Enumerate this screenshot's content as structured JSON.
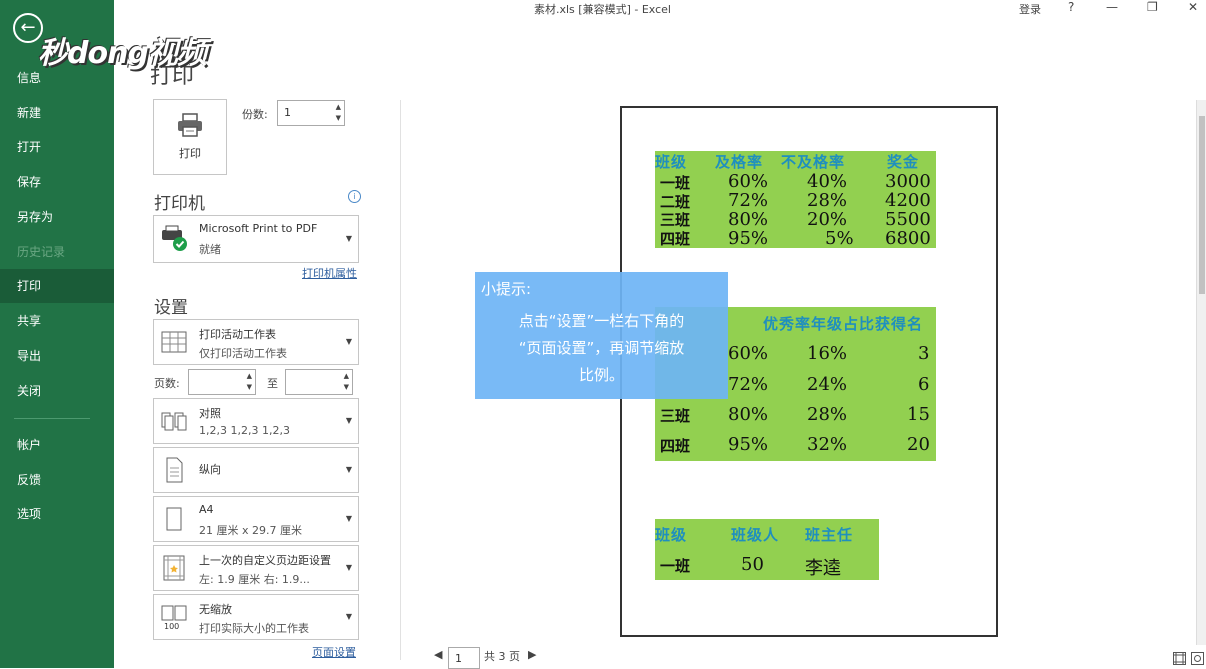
{
  "window": {
    "title": "素材.xls  [兼容模式]  -  Excel",
    "login": "登录",
    "help": "?",
    "minimize": "—",
    "restore": "❐",
    "close": "✕"
  },
  "watermark": "秒dong视频",
  "sidebar": {
    "back": "←",
    "items": [
      {
        "label": "信息"
      },
      {
        "label": "新建"
      },
      {
        "label": "打开"
      },
      {
        "label": "保存"
      },
      {
        "label": "另存为"
      },
      {
        "label": "历史记录"
      },
      {
        "label": "打印"
      },
      {
        "label": "共享"
      },
      {
        "label": "导出"
      },
      {
        "label": "关闭"
      },
      {
        "label": "帐户"
      },
      {
        "label": "反馈"
      },
      {
        "label": "选项"
      }
    ]
  },
  "print": {
    "heading": "打印",
    "button_label": "打印",
    "copies_label": "份数:",
    "copies_value": "1",
    "printer_section": "打印机",
    "printer_name": "Microsoft Print to PDF",
    "printer_status": "就绪",
    "printer_props": "打印机属性",
    "settings_section": "设置",
    "active_sheet": {
      "l1": "打印活动工作表",
      "l2": "仅打印活动工作表"
    },
    "pages_label": "页数:",
    "pages_to": "至",
    "collate": {
      "l1": "对照",
      "l2": "1,2,3    1,2,3    1,2,3"
    },
    "orientation": {
      "l1": "纵向"
    },
    "paper": {
      "l1": "A4",
      "l2": "21 厘米 x 29.7 厘米"
    },
    "margins": {
      "l1": "上一次的自定义页边距设置",
      "l2": "左: 1.9 厘米    右: 1.9..."
    },
    "scaling": {
      "l1": "无缩放",
      "l2": "打印实际大小的工作表"
    },
    "page_setup": "页面设置"
  },
  "preview": {
    "table1": {
      "headers": [
        "班级",
        "及格率",
        "不及格率",
        "奖金"
      ],
      "rows": [
        [
          "一班",
          "60%",
          "40%",
          "3000"
        ],
        [
          "二班",
          "72%",
          "28%",
          "4200"
        ],
        [
          "三班",
          "80%",
          "20%",
          "5500"
        ],
        [
          "四班",
          "95%",
          "5%",
          "6800"
        ]
      ]
    },
    "table2": {
      "header": "优秀率年级占比获得名",
      "rows": [
        [
          "",
          "60%",
          "16%",
          "3"
        ],
        [
          "",
          "72%",
          "24%",
          "6"
        ],
        [
          "三班",
          "80%",
          "28%",
          "15"
        ],
        [
          "四班",
          "95%",
          "32%",
          "20"
        ]
      ]
    },
    "table3": {
      "headers": [
        "班级",
        "班级人",
        "班主任"
      ],
      "rows": [
        [
          "一班",
          "50",
          "李逵"
        ]
      ]
    },
    "page_number": "1",
    "page_total": "共 3 页"
  },
  "tip": {
    "title": "小提示:",
    "line1": "点击“设置”一栏右下角的",
    "line2": "“页面设置”，再调节缩放",
    "line3": "比例。"
  },
  "colors": {
    "sidebar": "#217346",
    "table_fill": "#92d050",
    "tip_bg": "#6eb4f5"
  }
}
